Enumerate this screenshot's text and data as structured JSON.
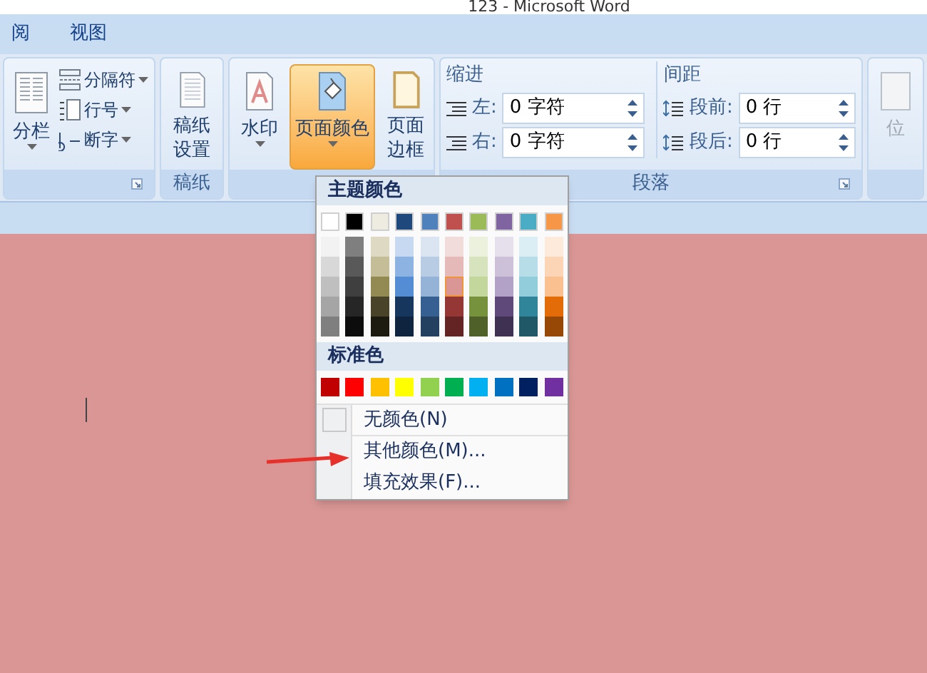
{
  "window": {
    "title": "123 - Microsoft Word"
  },
  "tabs": [
    {
      "label": "阅",
      "selected": false
    },
    {
      "label": "视图",
      "selected": false
    }
  ],
  "ribbon": {
    "groups": [
      {
        "kind": "page_setup",
        "big": {
          "label": "分栏"
        },
        "small": [
          {
            "label": "分隔符"
          },
          {
            "label": "行号"
          },
          {
            "label": "断字"
          }
        ]
      },
      {
        "kind": "paper",
        "label": "稿纸",
        "big": [
          {
            "label": "稿纸设置",
            "selected": false
          }
        ]
      },
      {
        "kind": "background",
        "big": [
          {
            "label": "水印",
            "selected": false,
            "caret": true
          },
          {
            "label": "页面颜色",
            "selected": true,
            "caret": true
          },
          {
            "label": "页面边框",
            "selected": false,
            "caret": false
          }
        ]
      },
      {
        "kind": "paragraph",
        "label": "段落",
        "sections": [
          {
            "title": "缩进",
            "fields": [
              {
                "label": "左:",
                "value": "0 字符"
              },
              {
                "label": "右:",
                "value": "0 字符"
              }
            ]
          },
          {
            "title": "间距",
            "fields": [
              {
                "label": "段前:",
                "value": "0 行"
              },
              {
                "label": "段后:",
                "value": "0 行"
              }
            ]
          }
        ]
      },
      {
        "kind": "arrange",
        "big": [
          {
            "label": "位",
            "disabled": true
          }
        ]
      }
    ]
  },
  "color_menu": {
    "theme_heading": "主题颜色",
    "theme_colors": [
      {
        "color": "#ffffff",
        "shades": [
          {
            "color": "#f2f2f2",
            "selected": false
          },
          {
            "color": "#d8d8d8",
            "selected": false
          },
          {
            "color": "#bfbfbf",
            "selected": false
          },
          {
            "color": "#a5a5a5",
            "selected": false
          },
          {
            "color": "#7f7f7f",
            "selected": false
          }
        ],
        "selected": false
      },
      {
        "color": "#000000",
        "shades": [
          {
            "color": "#7f7f7f",
            "selected": false
          },
          {
            "color": "#595959",
            "selected": false
          },
          {
            "color": "#3f3f3f",
            "selected": false
          },
          {
            "color": "#262626",
            "selected": false
          },
          {
            "color": "#0c0c0c",
            "selected": false
          }
        ],
        "selected": false
      },
      {
        "color": "#eeece1",
        "shades": [
          {
            "color": "#ddd9c3",
            "selected": false
          },
          {
            "color": "#c4bd97",
            "selected": false
          },
          {
            "color": "#938953",
            "selected": false
          },
          {
            "color": "#494429",
            "selected": false
          },
          {
            "color": "#1d1b10",
            "selected": false
          }
        ],
        "selected": false
      },
      {
        "color": "#1f497d",
        "shades": [
          {
            "color": "#c6d9f0",
            "selected": false
          },
          {
            "color": "#8db3e2",
            "selected": false
          },
          {
            "color": "#548dd4",
            "selected": false
          },
          {
            "color": "#17365d",
            "selected": false
          },
          {
            "color": "#0f243e",
            "selected": false
          }
        ],
        "selected": false
      },
      {
        "color": "#4f81bd",
        "shades": [
          {
            "color": "#dbe5f1",
            "selected": false
          },
          {
            "color": "#b8cce4",
            "selected": false
          },
          {
            "color": "#95b3d7",
            "selected": false
          },
          {
            "color": "#366092",
            "selected": false
          },
          {
            "color": "#244061",
            "selected": false
          }
        ],
        "selected": false
      },
      {
        "color": "#c0504d",
        "shades": [
          {
            "color": "#f2dcdb",
            "selected": false
          },
          {
            "color": "#e5b9b7",
            "selected": false
          },
          {
            "color": "#d99694",
            "selected": true
          },
          {
            "color": "#953734",
            "selected": false
          },
          {
            "color": "#632423",
            "selected": false
          }
        ],
        "selected": false
      },
      {
        "color": "#9bbb59",
        "shades": [
          {
            "color": "#ebf1dd",
            "selected": false
          },
          {
            "color": "#d7e3bc",
            "selected": false
          },
          {
            "color": "#c3d69b",
            "selected": false
          },
          {
            "color": "#76923c",
            "selected": false
          },
          {
            "color": "#4f6128",
            "selected": false
          }
        ],
        "selected": false
      },
      {
        "color": "#8064a2",
        "shades": [
          {
            "color": "#e5e0ec",
            "selected": false
          },
          {
            "color": "#ccc1d9",
            "selected": false
          },
          {
            "color": "#b2a2c7",
            "selected": false
          },
          {
            "color": "#5f497a",
            "selected": false
          },
          {
            "color": "#3f3151",
            "selected": false
          }
        ],
        "selected": false
      },
      {
        "color": "#4bacc6",
        "shades": [
          {
            "color": "#dbeef3",
            "selected": false
          },
          {
            "color": "#b7dde8",
            "selected": false
          },
          {
            "color": "#92cddc",
            "selected": false
          },
          {
            "color": "#31859b",
            "selected": false
          },
          {
            "color": "#205867",
            "selected": false
          }
        ],
        "selected": false
      },
      {
        "color": "#f79646",
        "shades": [
          {
            "color": "#fdeada",
            "selected": false
          },
          {
            "color": "#fbd5b5",
            "selected": false
          },
          {
            "color": "#fac08f",
            "selected": false
          },
          {
            "color": "#e36c09",
            "selected": false
          },
          {
            "color": "#974806",
            "selected": false
          }
        ],
        "selected": false
      }
    ],
    "standard_heading": "标准色",
    "standard_colors": [
      {
        "color": "#c00000",
        "selected": false
      },
      {
        "color": "#ff0000",
        "selected": false
      },
      {
        "color": "#ffc000",
        "selected": false
      },
      {
        "color": "#ffff00",
        "selected": false
      },
      {
        "color": "#92d050",
        "selected": false
      },
      {
        "color": "#00b050",
        "selected": false
      },
      {
        "color": "#00b0f0",
        "selected": false
      },
      {
        "color": "#0070c0",
        "selected": false
      },
      {
        "color": "#002060",
        "selected": false
      },
      {
        "color": "#7030a0",
        "selected": false
      }
    ],
    "items": [
      {
        "kind": "no_color",
        "label": "无颜色(N)"
      },
      {
        "kind": "more",
        "label": "其他颜色(M)..."
      },
      {
        "kind": "fill",
        "label": "填充效果(F)..."
      }
    ]
  }
}
